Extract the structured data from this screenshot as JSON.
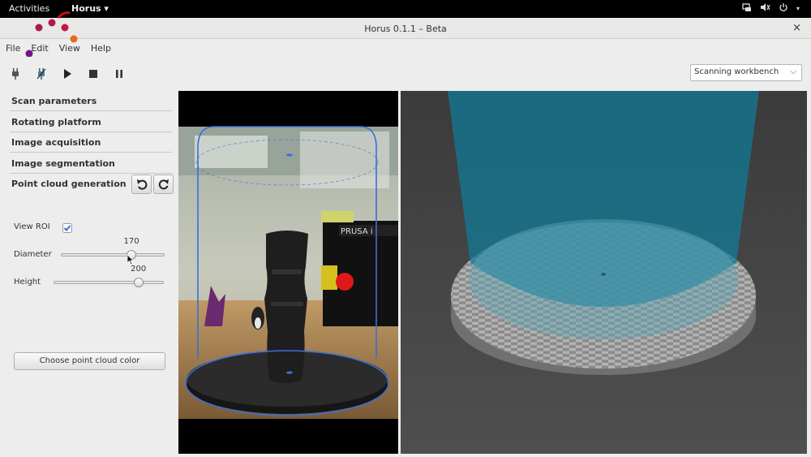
{
  "topbar": {
    "activities": "Activities",
    "app_menu": "Horus ▾"
  },
  "window": {
    "title": "Horus 0.1.1 – Beta",
    "close": "×"
  },
  "menu": [
    "File",
    "Edit",
    "View",
    "Help"
  ],
  "workbench": {
    "selected": "Scanning workbench"
  },
  "panel": {
    "sections": [
      "Scan parameters",
      "Rotating platform",
      "Image acquisition",
      "Image segmentation",
      "Point cloud generation"
    ],
    "view_roi_label": "View ROI",
    "view_roi_checked": true,
    "diameter_label": "Diameter",
    "diameter_value": "170",
    "diameter_fraction": 0.68,
    "height_label": "Height",
    "height_value": "200",
    "height_fraction": 0.77,
    "color_button": "Choose point cloud color"
  },
  "camera": {
    "printer_label": "PRUSA i"
  },
  "colors": {
    "accent_blue": "#3a6fd8",
    "roi_cyan": "#127a96"
  }
}
